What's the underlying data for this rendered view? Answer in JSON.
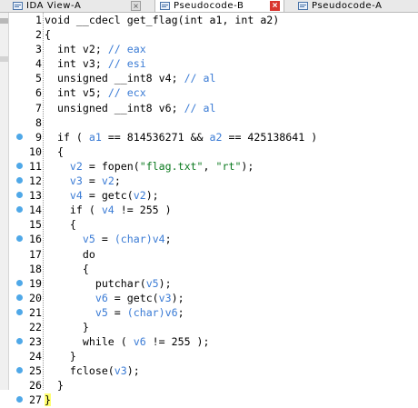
{
  "tabs": [
    {
      "label": "IDA View-A",
      "active": false
    },
    {
      "label": "Pseudocode-B",
      "active": true
    },
    {
      "label": "Pseudocode-A",
      "active": false
    }
  ],
  "code": {
    "lines": [
      {
        "n": "1",
        "dot": false,
        "parts": [
          [
            "k",
            "void __cdecl get_flag(int a1, int a2)"
          ]
        ]
      },
      {
        "n": "2",
        "dot": false,
        "parts": [
          [
            "k",
            "{"
          ]
        ]
      },
      {
        "n": "3",
        "dot": false,
        "parts": [
          [
            "k",
            "  int v2; "
          ],
          [
            "c",
            "// eax"
          ]
        ]
      },
      {
        "n": "4",
        "dot": false,
        "parts": [
          [
            "k",
            "  int v3; "
          ],
          [
            "c",
            "// esi"
          ]
        ]
      },
      {
        "n": "5",
        "dot": false,
        "parts": [
          [
            "k",
            "  unsigned __int8 v4; "
          ],
          [
            "c",
            "// al"
          ]
        ]
      },
      {
        "n": "6",
        "dot": false,
        "parts": [
          [
            "k",
            "  int v5; "
          ],
          [
            "c",
            "// ecx"
          ]
        ]
      },
      {
        "n": "7",
        "dot": false,
        "parts": [
          [
            "k",
            "  unsigned __int8 v6; "
          ],
          [
            "c",
            "// al"
          ]
        ]
      },
      {
        "n": "8",
        "dot": false,
        "parts": []
      },
      {
        "n": "9",
        "dot": true,
        "parts": [
          [
            "k",
            "  if ( "
          ],
          [
            "v",
            "a1"
          ],
          [
            "k",
            " == 814536271 && "
          ],
          [
            "v",
            "a2"
          ],
          [
            "k",
            " == 425138641 )"
          ]
        ]
      },
      {
        "n": "10",
        "dot": false,
        "parts": [
          [
            "k",
            "  {"
          ]
        ]
      },
      {
        "n": "11",
        "dot": true,
        "parts": [
          [
            "k",
            "    "
          ],
          [
            "n",
            "v2"
          ],
          [
            "k",
            " = fopen("
          ],
          [
            "s",
            "\"flag.txt\""
          ],
          [
            "k",
            ", "
          ],
          [
            "s",
            "\"rt\""
          ],
          [
            "k",
            ");"
          ]
        ]
      },
      {
        "n": "12",
        "dot": true,
        "parts": [
          [
            "k",
            "    "
          ],
          [
            "n",
            "v3"
          ],
          [
            "k",
            " = "
          ],
          [
            "n",
            "v2"
          ],
          [
            "k",
            ";"
          ]
        ]
      },
      {
        "n": "13",
        "dot": true,
        "parts": [
          [
            "k",
            "    "
          ],
          [
            "n",
            "v4"
          ],
          [
            "k",
            " = getc("
          ],
          [
            "n",
            "v2"
          ],
          [
            "k",
            ");"
          ]
        ]
      },
      {
        "n": "14",
        "dot": true,
        "parts": [
          [
            "k",
            "    if ( "
          ],
          [
            "n",
            "v4"
          ],
          [
            "k",
            " != 255 )"
          ]
        ]
      },
      {
        "n": "15",
        "dot": false,
        "parts": [
          [
            "k",
            "    {"
          ]
        ]
      },
      {
        "n": "16",
        "dot": true,
        "parts": [
          [
            "k",
            "      "
          ],
          [
            "n",
            "v5"
          ],
          [
            "k",
            " = "
          ],
          [
            "cast",
            "(char)"
          ],
          [
            "n",
            "v4"
          ],
          [
            "k",
            ";"
          ]
        ]
      },
      {
        "n": "17",
        "dot": false,
        "parts": [
          [
            "k",
            "      do"
          ]
        ]
      },
      {
        "n": "18",
        "dot": false,
        "parts": [
          [
            "k",
            "      {"
          ]
        ]
      },
      {
        "n": "19",
        "dot": true,
        "parts": [
          [
            "k",
            "        putchar("
          ],
          [
            "n",
            "v5"
          ],
          [
            "k",
            ");"
          ]
        ]
      },
      {
        "n": "20",
        "dot": true,
        "parts": [
          [
            "k",
            "        "
          ],
          [
            "n",
            "v6"
          ],
          [
            "k",
            " = getc("
          ],
          [
            "n",
            "v3"
          ],
          [
            "k",
            ");"
          ]
        ]
      },
      {
        "n": "21",
        "dot": true,
        "parts": [
          [
            "k",
            "        "
          ],
          [
            "n",
            "v5"
          ],
          [
            "k",
            " = "
          ],
          [
            "cast",
            "(char)"
          ],
          [
            "n",
            "v6"
          ],
          [
            "k",
            ";"
          ]
        ]
      },
      {
        "n": "22",
        "dot": false,
        "parts": [
          [
            "k",
            "      }"
          ]
        ]
      },
      {
        "n": "23",
        "dot": true,
        "parts": [
          [
            "k",
            "      while ( "
          ],
          [
            "n",
            "v6"
          ],
          [
            "k",
            " != 255 );"
          ]
        ]
      },
      {
        "n": "24",
        "dot": false,
        "parts": [
          [
            "k",
            "    }"
          ]
        ]
      },
      {
        "n": "25",
        "dot": true,
        "parts": [
          [
            "k",
            "    fclose("
          ],
          [
            "n",
            "v3"
          ],
          [
            "k",
            ");"
          ]
        ]
      },
      {
        "n": "26",
        "dot": false,
        "parts": [
          [
            "k",
            "  }"
          ]
        ]
      },
      {
        "n": "27",
        "dot": true,
        "parts": [
          [
            "hl",
            "}"
          ]
        ]
      }
    ]
  }
}
